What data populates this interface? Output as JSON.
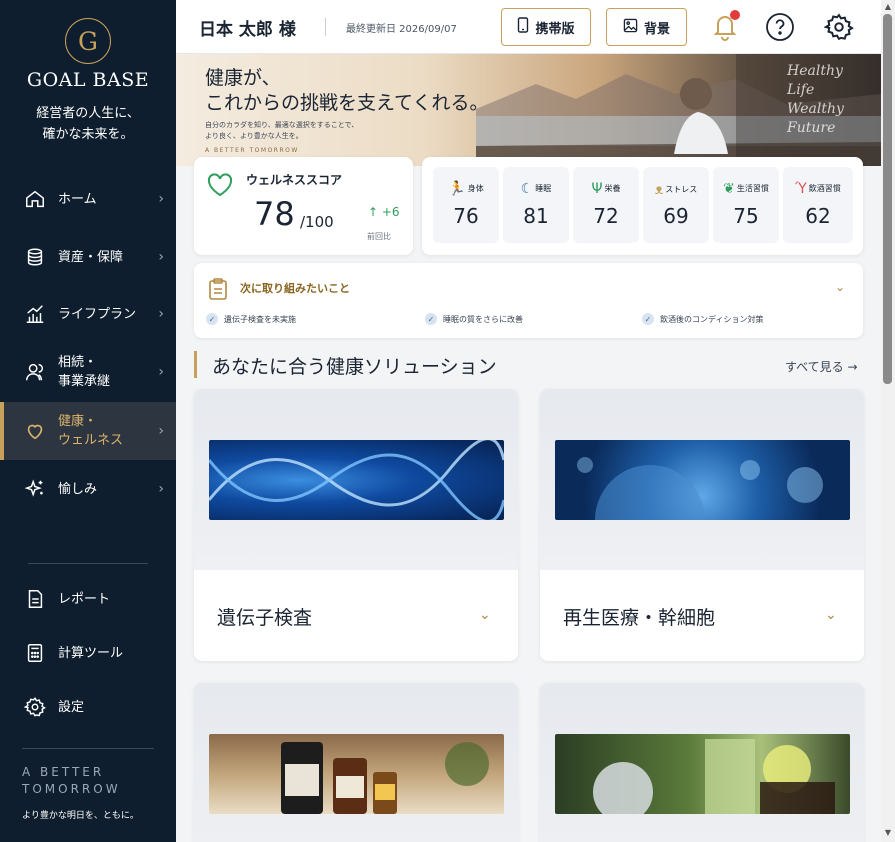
{
  "sidebar": {
    "logo_letter": "G",
    "logo_text": "GOAL BASE",
    "tagline": [
      "経営者の人生に、",
      "確かな未来を。"
    ],
    "nav": [
      {
        "label": "ホーム",
        "icon": "home-icon"
      },
      {
        "label": "資産・保障",
        "icon": "coins-icon"
      },
      {
        "label": "ライフプラン",
        "icon": "growth-chart-icon"
      },
      {
        "label": "相続・\n事業承継",
        "icon": "users-icon"
      },
      {
        "label": "健康・\nウェルネス",
        "icon": "heart-icon",
        "active": true
      },
      {
        "label": "愉しみ",
        "icon": "sparkle-icon"
      }
    ],
    "bottom": [
      {
        "label": "レポート",
        "icon": "document-icon"
      },
      {
        "label": "計算ツール",
        "icon": "calculator-icon"
      },
      {
        "label": "設定",
        "icon": "gear-icon"
      }
    ],
    "footer_motto": "A BETTER\nTOMORROW",
    "footer_sub": "より豊かな明日を、ともに。"
  },
  "header": {
    "user_name": "日本 太郎 様",
    "last_updated": "最終更新日 2026/09/07",
    "btn_mobile": "携帯版",
    "btn_background": "背景"
  },
  "hero": {
    "title_line1": "健康が、",
    "title_line2": "これからの挑戦を支えてくれる。",
    "subtitle_line1": "自分のカラダを知り、最適な選択をすることで、",
    "subtitle_line2": "より良く、より豊かな人生を。",
    "small": "A BETTER TOMORROW",
    "script": [
      "Healthy",
      "Life",
      "Wealthy",
      "Future"
    ]
  },
  "wellness": {
    "label": "ウェルネススコア",
    "score": "78",
    "max": "/100",
    "delta": "↑ +6",
    "delta_label": "前回比"
  },
  "metrics": [
    {
      "label": "身体",
      "value": "76",
      "icon": "running-icon",
      "color": "#2f9d5c"
    },
    {
      "label": "睡眠",
      "value": "81",
      "icon": "moon-icon",
      "color": "#3a6ea5"
    },
    {
      "label": "栄養",
      "value": "72",
      "icon": "fork-knife-icon",
      "color": "#2f9d5c"
    },
    {
      "label": "ストレス",
      "value": "69",
      "icon": "brain-icon",
      "color": "#c7a15b"
    },
    {
      "label": "生活習慣",
      "value": "75",
      "icon": "leaf-icon",
      "color": "#2f9d5c"
    },
    {
      "label": "飲酒習慣",
      "value": "62",
      "icon": "cocktail-icon",
      "color": "#d9534f"
    }
  ],
  "next_actions": {
    "title": "次に取り組みたいこと",
    "items": [
      "遺伝子検査を未実施",
      "睡眠の質をさらに改善",
      "飲酒後のコンディション対策"
    ]
  },
  "solutions": {
    "title": "あなたに合う健康ソリューション",
    "see_all": "すべて見る →",
    "cards": [
      {
        "title": "遺伝子検査"
      },
      {
        "title": "再生医療・幹細胞"
      },
      {
        "title": ""
      },
      {
        "title": ""
      }
    ]
  },
  "colors": {
    "accent": "#c7a15b",
    "sidebar_bg": "#0e1e2e",
    "alert": "#e23b3b"
  }
}
